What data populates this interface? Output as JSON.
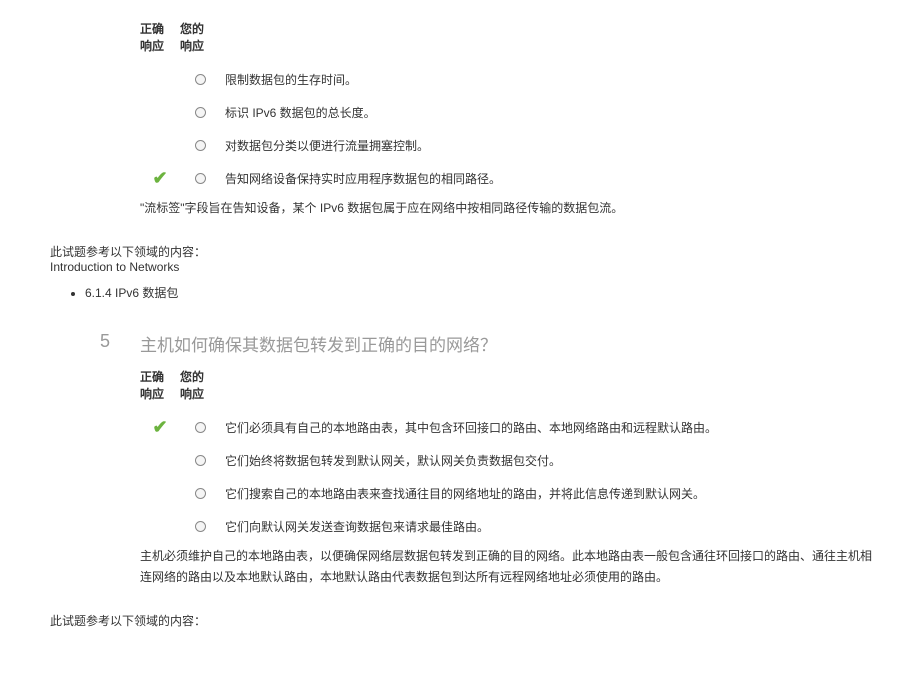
{
  "headers": {
    "correct_line1": "正确",
    "correct_line2": "响应",
    "your_line1": "您的",
    "your_line2": "响应"
  },
  "q4": {
    "options": [
      {
        "text": "限制数据包的生存时间。",
        "correct": false
      },
      {
        "text": "标识 IPv6 数据包的总长度。",
        "correct": false
      },
      {
        "text": "对数据包分类以便进行流量拥塞控制。",
        "correct": false
      },
      {
        "text": "告知网络设备保持实时应用程序数据包的相同路径。",
        "correct": true
      }
    ],
    "explanation": "\"流标签\"字段旨在告知设备，某个 IPv6 数据包属于应在网络中按相同路径传输的数据包流。",
    "reference_label": "此试题参考以下领域的内容：",
    "reference_title": "Introduction to Networks",
    "reference_item": "6.1.4 IPv6 数据包"
  },
  "q5": {
    "number": "5",
    "title": "主机如何确保其数据包转发到正确的目的网络？",
    "options": [
      {
        "text": "它们必须具有自己的本地路由表，其中包含环回接口的路由、本地网络路由和远程默认路由。",
        "correct": true
      },
      {
        "text": "它们始终将数据包转发到默认网关，默认网关负责数据包交付。",
        "correct": false
      },
      {
        "text": "它们搜索自己的本地路由表来查找通往目的网络地址的路由，并将此信息传递到默认网关。",
        "correct": false
      },
      {
        "text": "它们向默认网关发送查询数据包来请求最佳路由。",
        "correct": false
      }
    ],
    "explanation": "主机必须维护自己的本地路由表，以便确保网络层数据包转发到正确的目的网络。此本地路由表一般包含通往环回接口的路由、通往主机相连网络的路由以及本地默认路由，本地默认路由代表数据包到达所有远程网络地址必须使用的路由。",
    "reference_label": "此试题参考以下领域的内容："
  }
}
